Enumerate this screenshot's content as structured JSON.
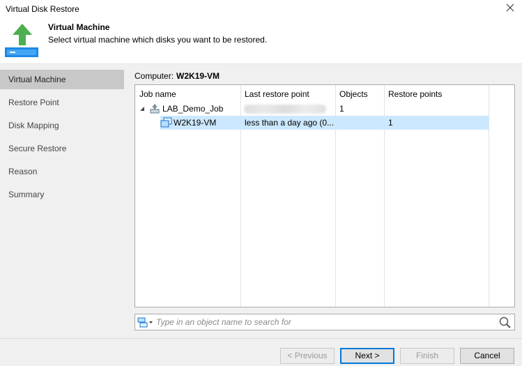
{
  "window": {
    "title": "Virtual Disk Restore"
  },
  "header": {
    "title": "Virtual Machine",
    "subtitle": "Select virtual machine which disks you want to be restored."
  },
  "sidebar": {
    "items": [
      {
        "label": "Virtual Machine",
        "active": true
      },
      {
        "label": "Restore Point",
        "active": false
      },
      {
        "label": "Disk Mapping",
        "active": false
      },
      {
        "label": "Secure Restore",
        "active": false
      },
      {
        "label": "Reason",
        "active": false
      },
      {
        "label": "Summary",
        "active": false
      }
    ]
  },
  "computer": {
    "label": "Computer:",
    "value": "W2K19-VM"
  },
  "grid": {
    "columns": [
      "Job name",
      "Last restore point",
      "Objects",
      "Restore points"
    ],
    "rows": [
      {
        "name": "LAB_Demo_Job",
        "last_restore_point": "",
        "objects": "1",
        "restore_points": "",
        "expanded": true
      },
      {
        "name": "W2K19-VM",
        "last_restore_point": "less than a day ago (0...",
        "objects": "",
        "restore_points": "1",
        "selected": true
      }
    ]
  },
  "search": {
    "placeholder": "Type in an object name to search for",
    "value": ""
  },
  "buttons": {
    "previous": "< Previous",
    "next": "Next >",
    "finish": "Finish",
    "cancel": "Cancel"
  },
  "colors": {
    "selection": "#cce8ff",
    "sidebar_bg": "#f0f0f0",
    "sidebar_active": "#c8c8c8",
    "arrow_green": "#4caf50",
    "accent_blue": "#0078d7"
  },
  "icons": {
    "close": "close-icon",
    "header": "restore-arrow-icon",
    "job": "backup-job-icon",
    "vm": "virtual-machine-icon",
    "search_type": "object-type-dropdown-icon",
    "search": "search-icon"
  }
}
